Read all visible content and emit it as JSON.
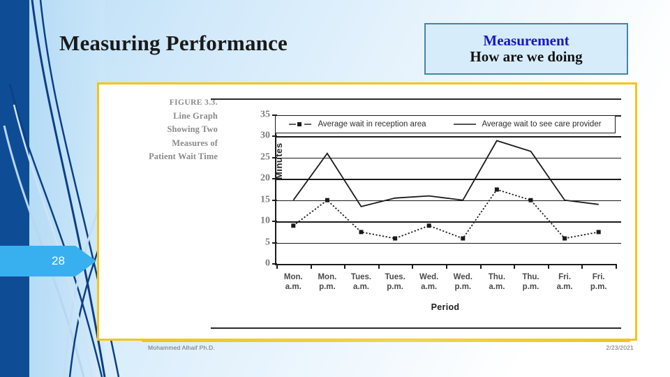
{
  "slide": {
    "title": "Measuring Performance",
    "page_number": "28",
    "footer_left": "Mohammed Alhaif Ph.D.",
    "footer_right": "2/23/2021",
    "accent_yellow": "#f5c518",
    "accent_blue": "#38b0f0",
    "dark_blue": "#0e4d96"
  },
  "callout": {
    "line1": "Measurement",
    "line2": "How are we doing",
    "line1_color": "#1616c8",
    "border_color": "#3f87a8",
    "background": "#d7ecfa"
  },
  "figure": {
    "caption_lines": [
      "FIGURE 3.3.",
      "Line Graph",
      "Showing Two",
      "Measures of",
      "Patient Wait Time"
    ]
  },
  "chart_data": {
    "type": "line",
    "title": "",
    "xlabel": "Period",
    "ylabel": "Minutes",
    "ylim": [
      0,
      35
    ],
    "yticks": [
      0,
      5,
      10,
      15,
      20,
      25,
      30,
      35
    ],
    "grid": true,
    "legend_position": "top",
    "categories": [
      "Mon. a.m.",
      "Mon. p.m.",
      "Tues. a.m.",
      "Tues. p.m.",
      "Wed. a.m.",
      "Wed. p.m.",
      "Thu. a.m.",
      "Thu. p.m.",
      "Fri. a.m.",
      "Fri. p.m."
    ],
    "category_top": [
      "Mon.",
      "Mon.",
      "Tues.",
      "Tues.",
      "Wed.",
      "Wed.",
      "Thu.",
      "Thu.",
      "Fri.",
      "Fri."
    ],
    "category_bottom": [
      "a.m.",
      "p.m.",
      "a.m.",
      "p.m.",
      "a.m.",
      "p.m.",
      "a.m.",
      "p.m.",
      "a.m.",
      "p.m."
    ],
    "series": [
      {
        "name": "Average wait in reception area",
        "style": "dashed",
        "marker": "square",
        "color": "#1a1a1a",
        "values": [
          9,
          15,
          7.5,
          6,
          9,
          6,
          17.5,
          15,
          6,
          7.5
        ]
      },
      {
        "name": "Average wait to see care provider",
        "style": "solid",
        "marker": "none",
        "color": "#1a1a1a",
        "values": [
          15,
          26,
          13.5,
          15.5,
          16,
          15,
          29,
          26.5,
          15,
          14
        ]
      }
    ]
  }
}
